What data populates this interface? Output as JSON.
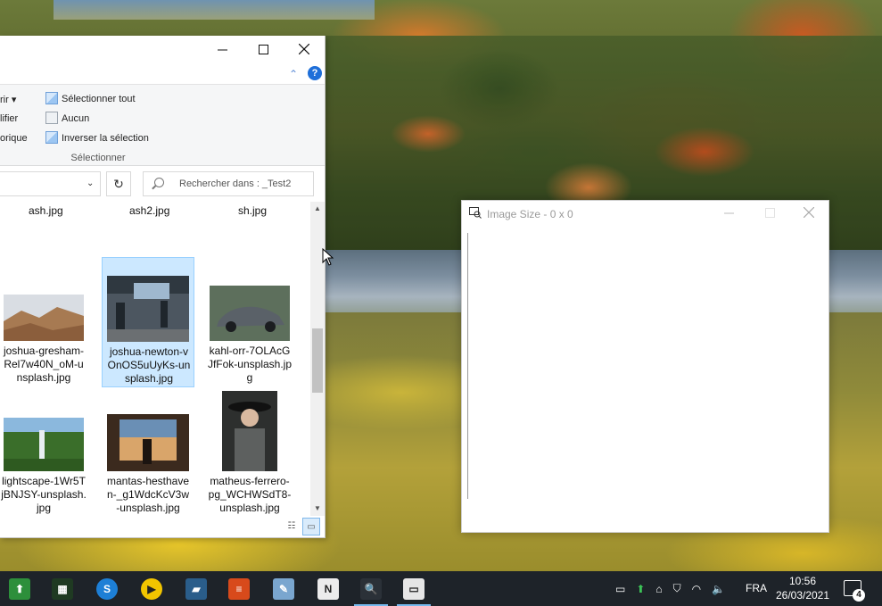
{
  "explorer": {
    "ribbon": {
      "partial_items": [
        "rir ▾",
        "lifier",
        "orique"
      ],
      "select_all": "Sélectionner tout",
      "select_none": "Aucun",
      "invert_selection": "Inverser la sélection",
      "group_label": "Sélectionner"
    },
    "search": {
      "placeholder": "Rechercher dans : _Test2"
    },
    "top_row_names": [
      "ash.jpg",
      "ash2.jpg",
      "sh.jpg"
    ],
    "files": [
      {
        "name": "joshua-gresham-Rel7w40N_oM-unsplash.jpg",
        "label": "joshua-gresham-\nRel7w40N_oM-u\nnsplash.jpg",
        "selected": false
      },
      {
        "name": "joshua-newton-vOnOS5uUyKs-unsplash.jpg",
        "label": "joshua-newton-v\nOnOS5uUyKs-un\nsplash.jpg",
        "selected": true
      },
      {
        "name": "kahl-orr-7OLAcGJfFok-unsplash.jpg",
        "label": "kahl-orr-7OLAcG\nJfFok-unsplash.jp\ng",
        "selected": false
      },
      {
        "name": "lightscape-1Wr5TjBNJSY-unsplash.jpg",
        "label": "lightscape-1Wr5T\njBNJSY-unsplash.\njpg",
        "selected": false
      },
      {
        "name": "mantas-hesthaven-_g1WdcKcV3w-unsplash.jpg",
        "label": "mantas-hesthave\nn-_g1WdcKcV3w\n-unsplash.jpg",
        "selected": false
      },
      {
        "name": "matheus-ferrero-pg_WCHWSdT8-unsplash.jpg",
        "label": "matheus-ferrero-\npg_WCHWSdT8-\nunsplash.jpg",
        "selected": false
      }
    ]
  },
  "image_window": {
    "title": "Image Size - 0 x 0"
  },
  "taskbar": {
    "language": "FRA",
    "time": "10:56",
    "date": "26/03/2021",
    "notification_count": "4"
  }
}
